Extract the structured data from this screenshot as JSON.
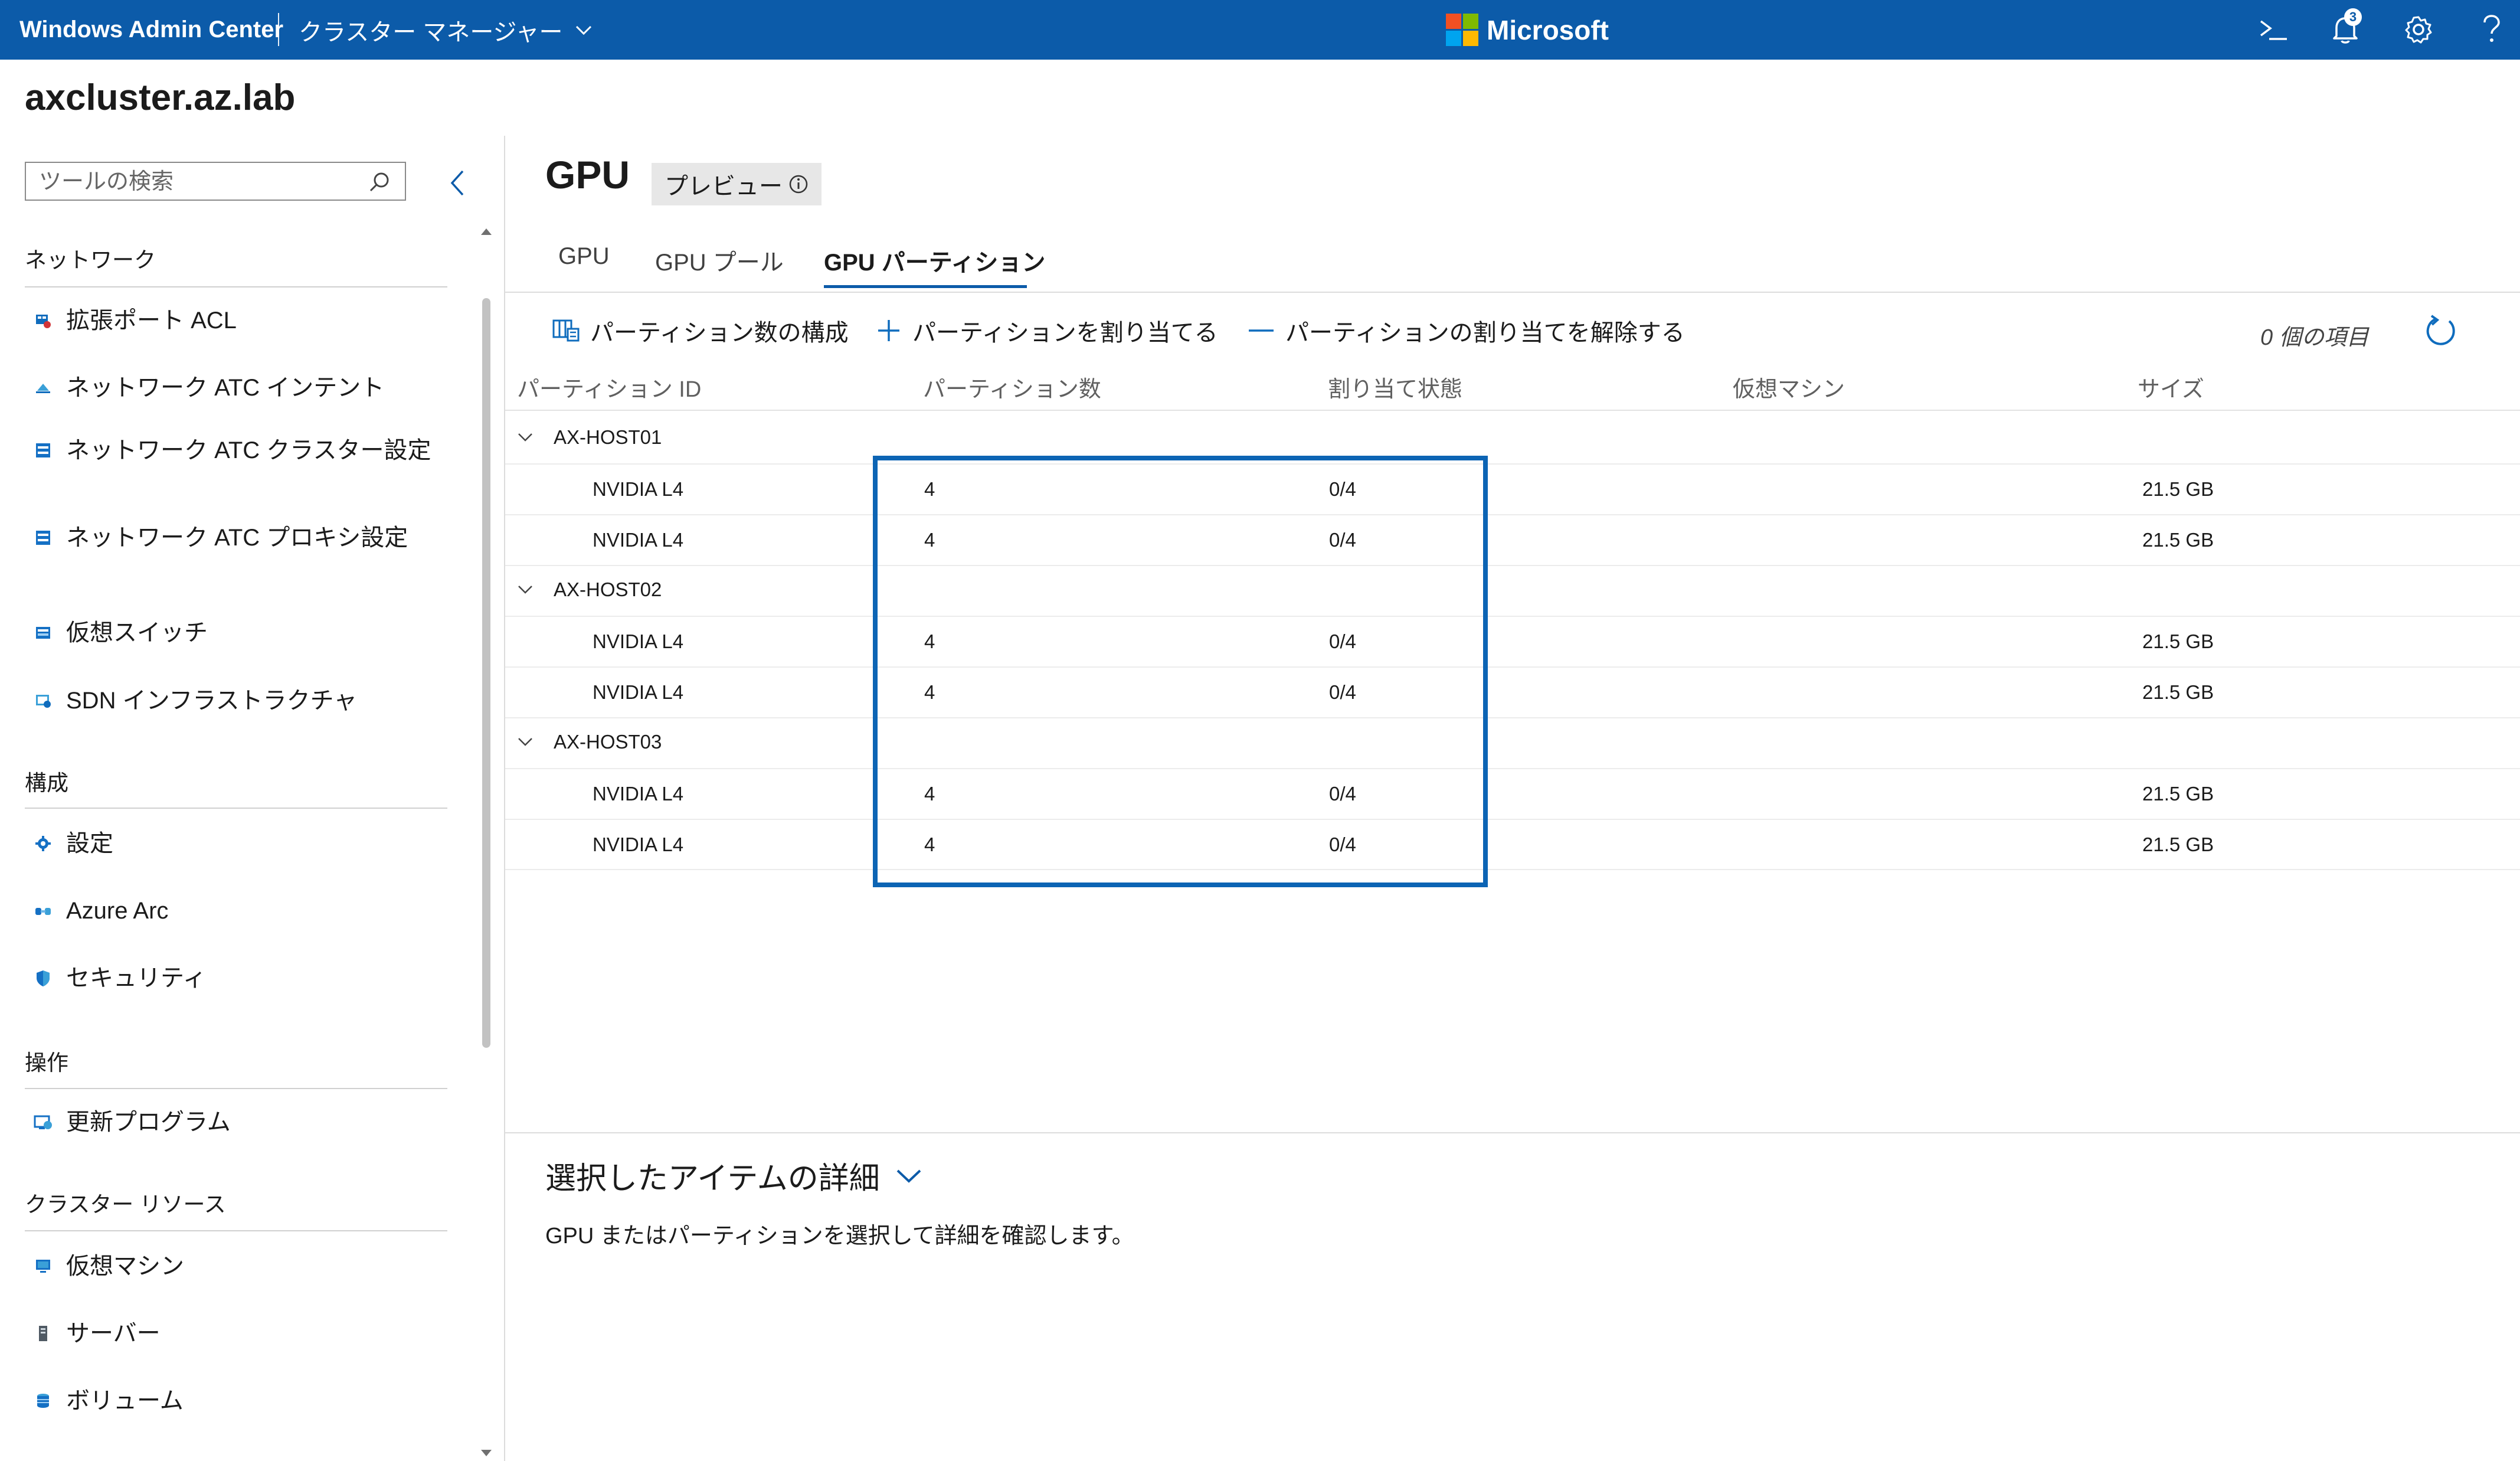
{
  "topbar": {
    "brand": "Windows Admin Center",
    "context": "クラスター マネージャー",
    "logo_text": "Microsoft",
    "notification_count": "3",
    "colors": {
      "bar": "#0c5ba9",
      "logo": [
        "#f25022",
        "#7fba00",
        "#00a4ef",
        "#ffb900"
      ]
    },
    "icons": [
      "powershell-icon",
      "notifications-icon",
      "settings-gear-icon",
      "help-icon"
    ]
  },
  "cluster_name": "axcluster.az.lab",
  "sidebar": {
    "search_placeholder": "ツールの検索",
    "sections": [
      {
        "title": "ネットワーク",
        "items": [
          {
            "label": "拡張ポート ACL",
            "icon": "port-acl-icon"
          },
          {
            "label": "ネットワーク ATC インテント",
            "icon": "network-intent-icon"
          },
          {
            "label": "ネットワーク ATC クラスター設定",
            "icon": "cluster-settings-icon"
          },
          {
            "label": "ネットワーク ATC プロキシ設定",
            "icon": "proxy-settings-icon"
          },
          {
            "label": "仮想スイッチ",
            "icon": "virtual-switch-icon"
          },
          {
            "label": "SDN インフラストラクチャ",
            "icon": "sdn-icon"
          }
        ]
      },
      {
        "title": "構成",
        "items": [
          {
            "label": "設定",
            "icon": "gear-icon"
          },
          {
            "label": "Azure Arc",
            "icon": "azure-arc-icon"
          },
          {
            "label": "セキュリティ",
            "icon": "shield-icon"
          }
        ]
      },
      {
        "title": "操作",
        "items": [
          {
            "label": "更新プログラム",
            "icon": "updates-icon"
          }
        ]
      },
      {
        "title": "クラスター リソース",
        "items": [
          {
            "label": "仮想マシン",
            "icon": "virtual-machine-icon"
          },
          {
            "label": "サーバー",
            "icon": "server-icon"
          },
          {
            "label": "ボリューム",
            "icon": "volume-icon"
          }
        ]
      }
    ]
  },
  "main": {
    "title": "GPU",
    "preview_label": "プレビュー",
    "tabs": [
      {
        "label": "GPU",
        "active": false
      },
      {
        "label": "GPU プール",
        "active": false
      },
      {
        "label": "GPU パーティション",
        "active": true
      }
    ],
    "commands": [
      {
        "label": "パーティション数の構成",
        "icon": "configure-partitions-icon"
      },
      {
        "label": "パーティションを割り当てる",
        "icon": "plus-icon"
      },
      {
        "label": "パーティションの割り当てを解除する",
        "icon": "minus-icon"
      }
    ],
    "item_count": "0 個の項目",
    "columns": [
      "パーティション ID",
      "パーティション数",
      "割り当て状態",
      "仮想マシン",
      "サイズ"
    ],
    "groups": [
      {
        "host": "AX-HOST01",
        "rows": [
          {
            "id": "NVIDIA L4",
            "count": "4",
            "assigned": "0/4",
            "vm": "",
            "size": "21.5 GB"
          },
          {
            "id": "NVIDIA L4",
            "count": "4",
            "assigned": "0/4",
            "vm": "",
            "size": "21.5 GB"
          }
        ]
      },
      {
        "host": "AX-HOST02",
        "rows": [
          {
            "id": "NVIDIA L4",
            "count": "4",
            "assigned": "0/4",
            "vm": "",
            "size": "21.5 GB"
          },
          {
            "id": "NVIDIA L4",
            "count": "4",
            "assigned": "0/4",
            "vm": "",
            "size": "21.5 GB"
          }
        ]
      },
      {
        "host": "AX-HOST03",
        "rows": [
          {
            "id": "NVIDIA L4",
            "count": "4",
            "assigned": "0/4",
            "vm": "",
            "size": "21.5 GB"
          },
          {
            "id": "NVIDIA L4",
            "count": "4",
            "assigned": "0/4",
            "vm": "",
            "size": "21.5 GB"
          }
        ]
      }
    ],
    "details": {
      "title": "選択したアイテムの詳細",
      "text": "GPU またはパーティションを選択して詳細を確認します。"
    },
    "accent_color": "#0c64b4"
  }
}
